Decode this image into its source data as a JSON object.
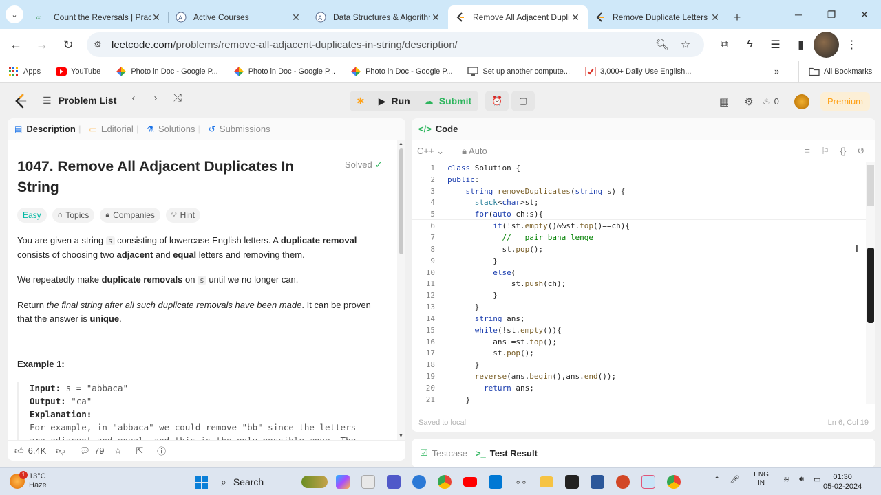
{
  "browser": {
    "tabs": [
      {
        "title": "Count the Reversals | Practic",
        "active": false
      },
      {
        "title": "Active Courses",
        "active": false
      },
      {
        "title": "Data Structures & Algorithm",
        "active": false
      },
      {
        "title": "Remove All Adjacent Duplic",
        "active": true
      },
      {
        "title": "Remove Duplicate Letters",
        "active": false
      }
    ],
    "url_host": "leetcode.com",
    "url_path": "/problems/remove-all-adjacent-duplicates-in-string/description/",
    "bookmarks": [
      {
        "label": "Apps"
      },
      {
        "label": "YouTube"
      },
      {
        "label": "Photo in Doc - Google P..."
      },
      {
        "label": "Photo in Doc - Google P..."
      },
      {
        "label": "Photo in Doc - Google P..."
      },
      {
        "label": "Set up another compute..."
      },
      {
        "label": "3,000+ Daily Use English..."
      }
    ],
    "all_bookmarks": "All Bookmarks"
  },
  "lc": {
    "problem_list": "Problem List",
    "run": "Run",
    "submit": "Submit",
    "streak_count": "0",
    "premium": "Premium",
    "left_tabs": [
      "Description",
      "Editorial",
      "Solutions",
      "Submissions"
    ],
    "code_tab": "Code",
    "language": "C++",
    "auto": "Auto",
    "saved": "Saved to local",
    "cursor_pos": "Ln 6, Col 19",
    "bottom_tabs": [
      "Testcase",
      "Test Result"
    ],
    "likes": "6.4K",
    "comments": "79"
  },
  "problem": {
    "title": "1047. Remove All Adjacent Duplicates In String",
    "status": "Solved",
    "difficulty": "Easy",
    "chips": [
      "Topics",
      "Companies",
      "Hint"
    ],
    "p1_a": "You are given a string ",
    "p1_code": "s",
    "p1_b": " consisting of lowercase English letters. A ",
    "p1_bold1": "duplicate removal",
    "p1_c": " consists of choosing two ",
    "p1_bold2": "adjacent",
    "p1_d": " and ",
    "p1_bold3": "equal",
    "p1_e": " letters and removing them.",
    "p2_a": "We repeatedly make ",
    "p2_bold": "duplicate removals",
    "p2_b": " on ",
    "p2_code": "s",
    "p2_c": " until we no longer can.",
    "p3_a": "Return ",
    "p3_italic": "the final string after all such duplicate removals have been made",
    "p3_b": ". It can be proven that the answer is ",
    "p3_bold": "unique",
    "p3_c": ".",
    "example_heading": "Example 1:",
    "ex_input_k": "Input:",
    "ex_input_v": " s = \"abbaca\"",
    "ex_output_k": "Output:",
    "ex_output_v": " \"ca\"",
    "ex_expl_k": "Explanation:",
    "ex_expl_1": "For example, in \"abbaca\" we could remove \"bb\" since the letters",
    "ex_expl_2": "are adjacent and equal, and this is the only possible move.  The"
  },
  "code_lines": [
    {
      "n": "1",
      "t": "class Solution {"
    },
    {
      "n": "2",
      "t": "public:"
    },
    {
      "n": "3",
      "t": "    string removeDuplicates(string s) {"
    },
    {
      "n": "4",
      "t": "      stack<char>st;"
    },
    {
      "n": "5",
      "t": "      for(auto ch:s){"
    },
    {
      "n": "6",
      "t": "          if(!st.empty()&&st.top()==ch){"
    },
    {
      "n": "7",
      "t": "            //   pair bana lenge"
    },
    {
      "n": "8",
      "t": "            st.pop();"
    },
    {
      "n": "9",
      "t": "          }"
    },
    {
      "n": "10",
      "t": "          else{"
    },
    {
      "n": "11",
      "t": "              st.push(ch);"
    },
    {
      "n": "12",
      "t": "          }"
    },
    {
      "n": "13",
      "t": "      }"
    },
    {
      "n": "14",
      "t": "      string ans;"
    },
    {
      "n": "15",
      "t": "      while(!st.empty()){"
    },
    {
      "n": "16",
      "t": "          ans+=st.top();"
    },
    {
      "n": "17",
      "t": "          st.pop();"
    },
    {
      "n": "18",
      "t": "      }"
    },
    {
      "n": "19",
      "t": "      reverse(ans.begin(),ans.end());"
    },
    {
      "n": "20",
      "t": "        return ans;"
    },
    {
      "n": "21",
      "t": "    }"
    }
  ],
  "taskbar": {
    "temp": "13°C",
    "weather": "Haze",
    "weather_badge": "1",
    "search": "Search",
    "lang1": "ENG",
    "lang2": "IN",
    "time": "01:30",
    "date": "05-02-2024"
  },
  "colors": {
    "accent_orange": "#ffa116",
    "submit_green": "#2db55d",
    "easy_teal": "#00b8a3",
    "tab_bar": "#cfe8f9"
  }
}
